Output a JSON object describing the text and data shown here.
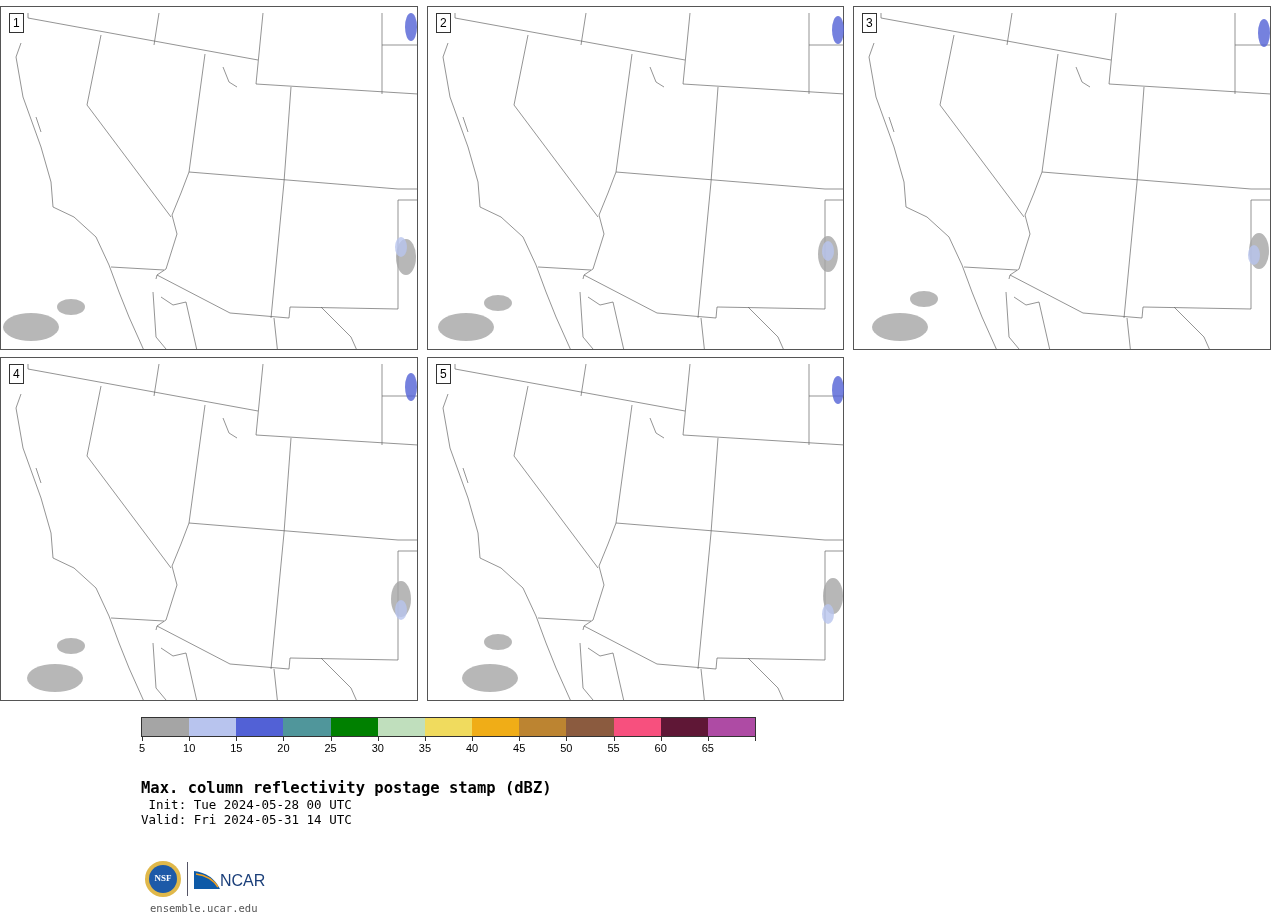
{
  "panels": [
    {
      "number": "1"
    },
    {
      "number": "2"
    },
    {
      "number": "3"
    },
    {
      "number": "4"
    },
    {
      "number": "5"
    }
  ],
  "colorbar": {
    "bins": [
      {
        "color": "#a5a5a5",
        "label": "5"
      },
      {
        "color": "#b8c4ee",
        "label": "10"
      },
      {
        "color": "#5261d6",
        "label": "15"
      },
      {
        "color": "#50969b",
        "label": "20"
      },
      {
        "color": "#008000",
        "label": "25"
      },
      {
        "color": "#c0dfbd",
        "label": "30"
      },
      {
        "color": "#f0db5e",
        "label": "35"
      },
      {
        "color": "#f0ad17",
        "label": "40"
      },
      {
        "color": "#bc8431",
        "label": "45"
      },
      {
        "color": "#8b5b3f",
        "label": "50"
      },
      {
        "color": "#f7507e",
        "label": "55"
      },
      {
        "color": "#5f1736",
        "label": "60"
      },
      {
        "color": "#ae4ba4",
        "label": "65"
      }
    ]
  },
  "title": "Max. column reflectivity postage stamp (dBZ)",
  "init": " Init: Tue 2024-05-28 00 UTC",
  "valid": "Valid: Fri 2024-05-31 14 UTC",
  "logo": {
    "nsf": "NSF",
    "ncar": "NCAR"
  },
  "site": "ensemble.ucar.edu"
}
